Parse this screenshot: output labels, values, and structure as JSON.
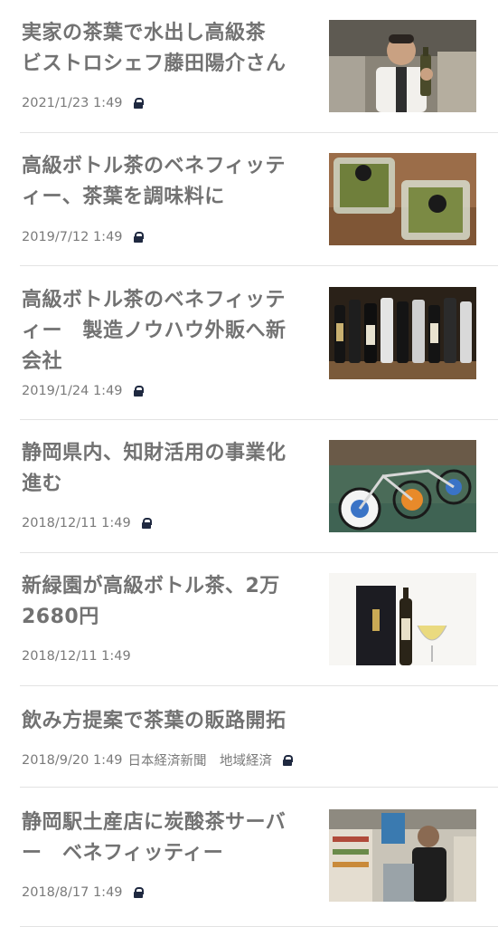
{
  "articles": [
    {
      "title": "実家の茶葉で水出し高級茶　ビストロシェフ藤田陽介さん",
      "date": "2021/1/23 1:49",
      "source": "",
      "locked": true,
      "thumbnail": "chef-holding-bottle-photo"
    },
    {
      "title": "高級ボトル茶のベネフィッティー、茶葉を調味料に",
      "date": "2019/7/12 1:49",
      "source": "",
      "locked": true,
      "thumbnail": "tea-leaf-packages-photo"
    },
    {
      "title": "高級ボトル茶のベネフィッティー　製造ノウハウ外販へ新会社",
      "date": "2019/1/24 1:49",
      "source": "",
      "locked": true,
      "thumbnail": "bottle-lineup-photo"
    },
    {
      "title": "静岡県内、知財活用の事業化進む",
      "date": "2018/12/11 1:49",
      "source": "",
      "locked": true,
      "thumbnail": "bicycles-photo"
    },
    {
      "title": "新緑園が高級ボトル茶、2万2680円",
      "date": "2018/12/11 1:49",
      "source": "",
      "locked": false,
      "thumbnail": "tea-bottle-glass-photo"
    },
    {
      "title": "飲み方提案で茶葉の販路開拓",
      "date": "2018/9/20 1:49",
      "source": "日本経済新聞　地域経済",
      "locked": true,
      "thumbnail": ""
    },
    {
      "title": "静岡駅土産店に炭酸茶サーバー　ベネフィッティー",
      "date": "2018/8/17 1:49",
      "source": "",
      "locked": true,
      "thumbnail": "shop-server-photo"
    }
  ]
}
